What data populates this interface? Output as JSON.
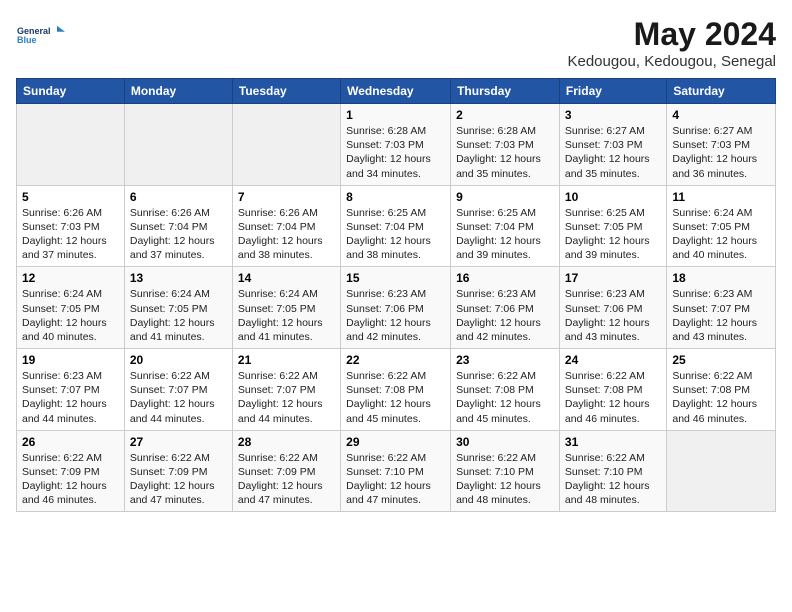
{
  "header": {
    "logo_line1": "General",
    "logo_line2": "Blue",
    "month": "May 2024",
    "location": "Kedougou, Kedougou, Senegal"
  },
  "days_of_week": [
    "Sunday",
    "Monday",
    "Tuesday",
    "Wednesday",
    "Thursday",
    "Friday",
    "Saturday"
  ],
  "weeks": [
    [
      {
        "day": "",
        "sunrise": "",
        "sunset": "",
        "daylight": ""
      },
      {
        "day": "",
        "sunrise": "",
        "sunset": "",
        "daylight": ""
      },
      {
        "day": "",
        "sunrise": "",
        "sunset": "",
        "daylight": ""
      },
      {
        "day": "1",
        "sunrise": "6:28 AM",
        "sunset": "7:03 PM",
        "daylight": "12 hours and 34 minutes."
      },
      {
        "day": "2",
        "sunrise": "6:28 AM",
        "sunset": "7:03 PM",
        "daylight": "12 hours and 35 minutes."
      },
      {
        "day": "3",
        "sunrise": "6:27 AM",
        "sunset": "7:03 PM",
        "daylight": "12 hours and 35 minutes."
      },
      {
        "day": "4",
        "sunrise": "6:27 AM",
        "sunset": "7:03 PM",
        "daylight": "12 hours and 36 minutes."
      }
    ],
    [
      {
        "day": "5",
        "sunrise": "6:26 AM",
        "sunset": "7:03 PM",
        "daylight": "12 hours and 37 minutes."
      },
      {
        "day": "6",
        "sunrise": "6:26 AM",
        "sunset": "7:04 PM",
        "daylight": "12 hours and 37 minutes."
      },
      {
        "day": "7",
        "sunrise": "6:26 AM",
        "sunset": "7:04 PM",
        "daylight": "12 hours and 38 minutes."
      },
      {
        "day": "8",
        "sunrise": "6:25 AM",
        "sunset": "7:04 PM",
        "daylight": "12 hours and 38 minutes."
      },
      {
        "day": "9",
        "sunrise": "6:25 AM",
        "sunset": "7:04 PM",
        "daylight": "12 hours and 39 minutes."
      },
      {
        "day": "10",
        "sunrise": "6:25 AM",
        "sunset": "7:05 PM",
        "daylight": "12 hours and 39 minutes."
      },
      {
        "day": "11",
        "sunrise": "6:24 AM",
        "sunset": "7:05 PM",
        "daylight": "12 hours and 40 minutes."
      }
    ],
    [
      {
        "day": "12",
        "sunrise": "6:24 AM",
        "sunset": "7:05 PM",
        "daylight": "12 hours and 40 minutes."
      },
      {
        "day": "13",
        "sunrise": "6:24 AM",
        "sunset": "7:05 PM",
        "daylight": "12 hours and 41 minutes."
      },
      {
        "day": "14",
        "sunrise": "6:24 AM",
        "sunset": "7:05 PM",
        "daylight": "12 hours and 41 minutes."
      },
      {
        "day": "15",
        "sunrise": "6:23 AM",
        "sunset": "7:06 PM",
        "daylight": "12 hours and 42 minutes."
      },
      {
        "day": "16",
        "sunrise": "6:23 AM",
        "sunset": "7:06 PM",
        "daylight": "12 hours and 42 minutes."
      },
      {
        "day": "17",
        "sunrise": "6:23 AM",
        "sunset": "7:06 PM",
        "daylight": "12 hours and 43 minutes."
      },
      {
        "day": "18",
        "sunrise": "6:23 AM",
        "sunset": "7:07 PM",
        "daylight": "12 hours and 43 minutes."
      }
    ],
    [
      {
        "day": "19",
        "sunrise": "6:23 AM",
        "sunset": "7:07 PM",
        "daylight": "12 hours and 44 minutes."
      },
      {
        "day": "20",
        "sunrise": "6:22 AM",
        "sunset": "7:07 PM",
        "daylight": "12 hours and 44 minutes."
      },
      {
        "day": "21",
        "sunrise": "6:22 AM",
        "sunset": "7:07 PM",
        "daylight": "12 hours and 44 minutes."
      },
      {
        "day": "22",
        "sunrise": "6:22 AM",
        "sunset": "7:08 PM",
        "daylight": "12 hours and 45 minutes."
      },
      {
        "day": "23",
        "sunrise": "6:22 AM",
        "sunset": "7:08 PM",
        "daylight": "12 hours and 45 minutes."
      },
      {
        "day": "24",
        "sunrise": "6:22 AM",
        "sunset": "7:08 PM",
        "daylight": "12 hours and 46 minutes."
      },
      {
        "day": "25",
        "sunrise": "6:22 AM",
        "sunset": "7:08 PM",
        "daylight": "12 hours and 46 minutes."
      }
    ],
    [
      {
        "day": "26",
        "sunrise": "6:22 AM",
        "sunset": "7:09 PM",
        "daylight": "12 hours and 46 minutes."
      },
      {
        "day": "27",
        "sunrise": "6:22 AM",
        "sunset": "7:09 PM",
        "daylight": "12 hours and 47 minutes."
      },
      {
        "day": "28",
        "sunrise": "6:22 AM",
        "sunset": "7:09 PM",
        "daylight": "12 hours and 47 minutes."
      },
      {
        "day": "29",
        "sunrise": "6:22 AM",
        "sunset": "7:10 PM",
        "daylight": "12 hours and 47 minutes."
      },
      {
        "day": "30",
        "sunrise": "6:22 AM",
        "sunset": "7:10 PM",
        "daylight": "12 hours and 48 minutes."
      },
      {
        "day": "31",
        "sunrise": "6:22 AM",
        "sunset": "7:10 PM",
        "daylight": "12 hours and 48 minutes."
      },
      {
        "day": "",
        "sunrise": "",
        "sunset": "",
        "daylight": ""
      }
    ]
  ],
  "labels": {
    "sunrise_prefix": "Sunrise: ",
    "sunset_prefix": "Sunset: ",
    "daylight_prefix": "Daylight: "
  }
}
